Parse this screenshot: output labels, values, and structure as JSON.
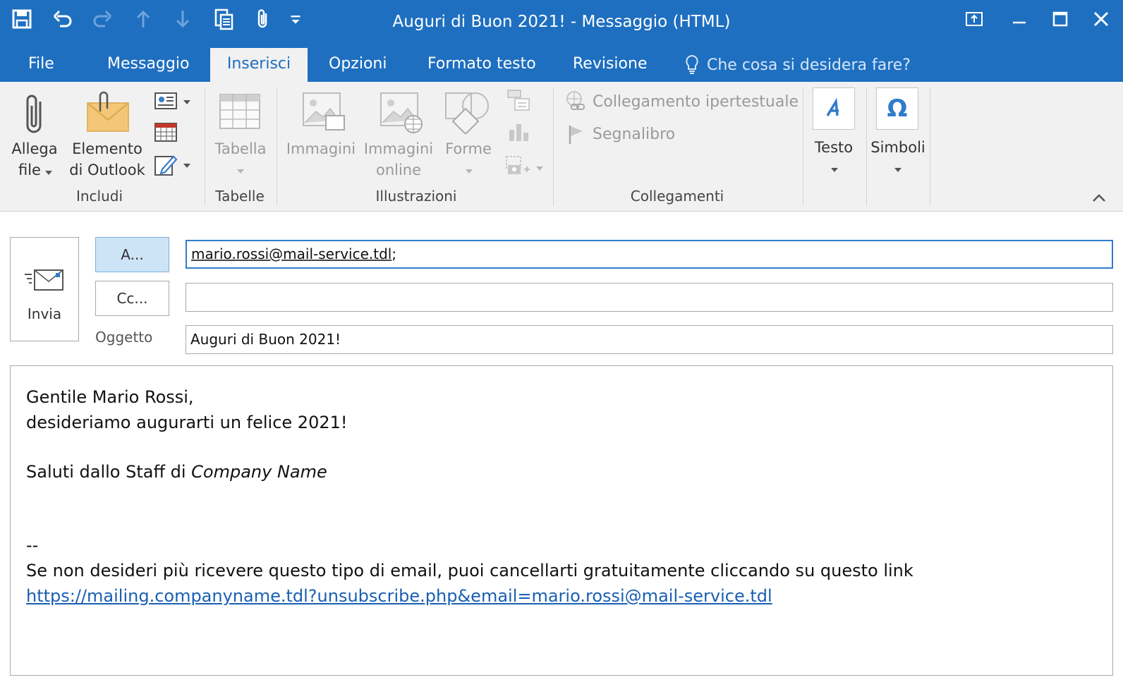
{
  "window": {
    "title": "Auguri di Buon 2021! - Messaggio (HTML)"
  },
  "colors": {
    "accent": "#1e6fc0",
    "ribbon_bg": "#f1f1f1",
    "link": "#1a5fb4"
  },
  "quick_access": [
    {
      "icon": "save-icon"
    },
    {
      "icon": "undo-icon"
    },
    {
      "icon": "redo-icon"
    },
    {
      "icon": "arrow-up-icon"
    },
    {
      "icon": "arrow-down-icon"
    },
    {
      "icon": "clipboard-icon"
    },
    {
      "icon": "paperclip-icon"
    },
    {
      "icon": "customize-dropdown-icon"
    }
  ],
  "tabs": [
    {
      "label": "File",
      "active": false
    },
    {
      "label": "Messaggio",
      "active": false
    },
    {
      "label": "Inserisci",
      "active": true
    },
    {
      "label": "Opzioni",
      "active": false
    },
    {
      "label": "Formato testo",
      "active": false
    },
    {
      "label": "Revisione",
      "active": false
    }
  ],
  "tell_me": {
    "placeholder": "Che cosa si desidera fare?",
    "icon": "lightbulb-icon"
  },
  "ribbon": {
    "groups": {
      "includi": "Includi",
      "tabelle": "Tabelle",
      "illustrazioni": "Illustrazioni",
      "collegamenti": "Collegamenti"
    },
    "allega_file": {
      "line1": "Allega",
      "line2": "file"
    },
    "elemento_outlook": {
      "line1": "Elemento",
      "line2": "di Outlook"
    },
    "tabella": "Tabella",
    "immagini": "Immagini",
    "immagini_online": {
      "line1": "Immagini",
      "line2": "online"
    },
    "forme": "Forme",
    "collegamento": "Collegamento ipertestuale",
    "segnalibro": "Segnalibro",
    "testo": "Testo",
    "simboli": "Simboli"
  },
  "compose": {
    "send_label": "Invia",
    "to_button": "A...",
    "cc_button": "Cc...",
    "to_address": "mario.rossi@mail-service.tdl",
    "to_separator": ";",
    "cc_value": "",
    "subject_label": "Oggetto",
    "subject_value": "Auguri di Buon 2021!"
  },
  "body": {
    "line1": "Gentile Mario Rossi,",
    "line2": "desideriamo augurarti un felice 2021!",
    "greeting_prefix": "Saluti dallo Staff di ",
    "company_name": "Company Name",
    "sig_separator": "--",
    "unsubscribe_text": "Se non desideri più ricevere questo tipo di email, puoi cancellarti gratuitamente cliccando su questo link",
    "unsubscribe_link": "https://mailing.companyname.tdl?unsubscribe.php&email=mario.rossi@mail-service.tdl"
  }
}
